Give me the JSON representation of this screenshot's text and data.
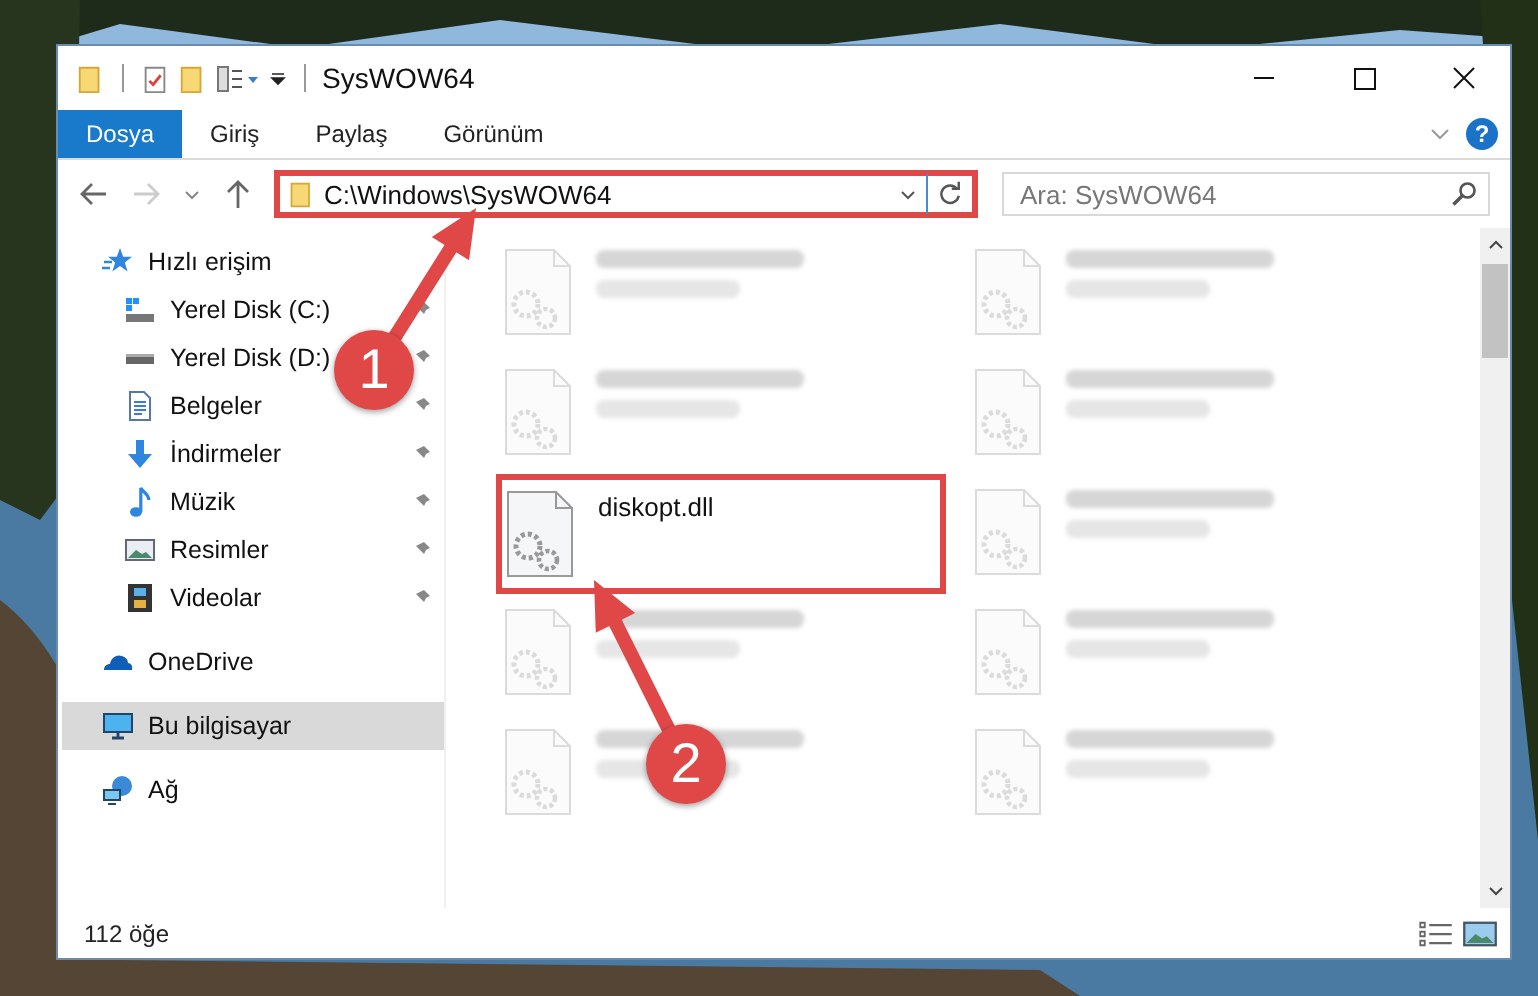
{
  "window": {
    "title": "SysWOW64"
  },
  "ribbon": {
    "tabs": [
      {
        "label": "Dosya",
        "selected": true
      },
      {
        "label": "Giriş",
        "selected": false
      },
      {
        "label": "Paylaş",
        "selected": false
      },
      {
        "label": "Görünüm",
        "selected": false
      }
    ],
    "help": "?"
  },
  "navigation": {
    "forward_disabled": true
  },
  "address_bar": {
    "path": "C:\\Windows\\SysWOW64",
    "highlighted": true
  },
  "search": {
    "placeholder": "Ara: SysWOW64"
  },
  "sidebar": {
    "items": [
      {
        "label": "Hızlı erişim",
        "kind": "star",
        "selected": false,
        "children": [
          {
            "label": "Yerel Disk (C:)",
            "kind": "system-drive",
            "pinned": true,
            "selected": false
          },
          {
            "label": "Yerel Disk (D:)",
            "kind": "drive",
            "pinned": true,
            "selected": false
          },
          {
            "label": "Belgeler",
            "kind": "documents",
            "pinned": true,
            "selected": false
          },
          {
            "label": "İndirmeler",
            "kind": "downloads",
            "pinned": true,
            "selected": false
          },
          {
            "label": "Müzik",
            "kind": "music",
            "pinned": true,
            "selected": false
          },
          {
            "label": "Resimler",
            "kind": "pictures",
            "pinned": true,
            "selected": false
          },
          {
            "label": "Videolar",
            "kind": "videos",
            "pinned": true,
            "selected": false
          }
        ]
      },
      {
        "label": "OneDrive",
        "kind": "cloud",
        "selected": false
      },
      {
        "label": "Bu bilgisayar",
        "kind": "computer",
        "selected": true
      },
      {
        "label": "Ağ",
        "kind": "network",
        "selected": false
      }
    ]
  },
  "files": [
    {
      "blurred": true,
      "highlighted": false
    },
    {
      "blurred": true,
      "highlighted": false
    },
    {
      "blurred": true,
      "highlighted": false
    },
    {
      "blurred": true,
      "highlighted": false
    },
    {
      "name": "diskopt.dll",
      "blurred": false,
      "highlighted": true
    },
    {
      "blurred": true,
      "highlighted": false
    },
    {
      "blurred": true,
      "highlighted": false
    },
    {
      "blurred": true,
      "highlighted": false
    },
    {
      "blurred": true,
      "highlighted": false
    },
    {
      "blurred": true,
      "highlighted": false
    }
  ],
  "status_bar": {
    "count": "112 öğe"
  },
  "annotations": [
    {
      "number": "1"
    },
    {
      "number": "2"
    }
  ]
}
